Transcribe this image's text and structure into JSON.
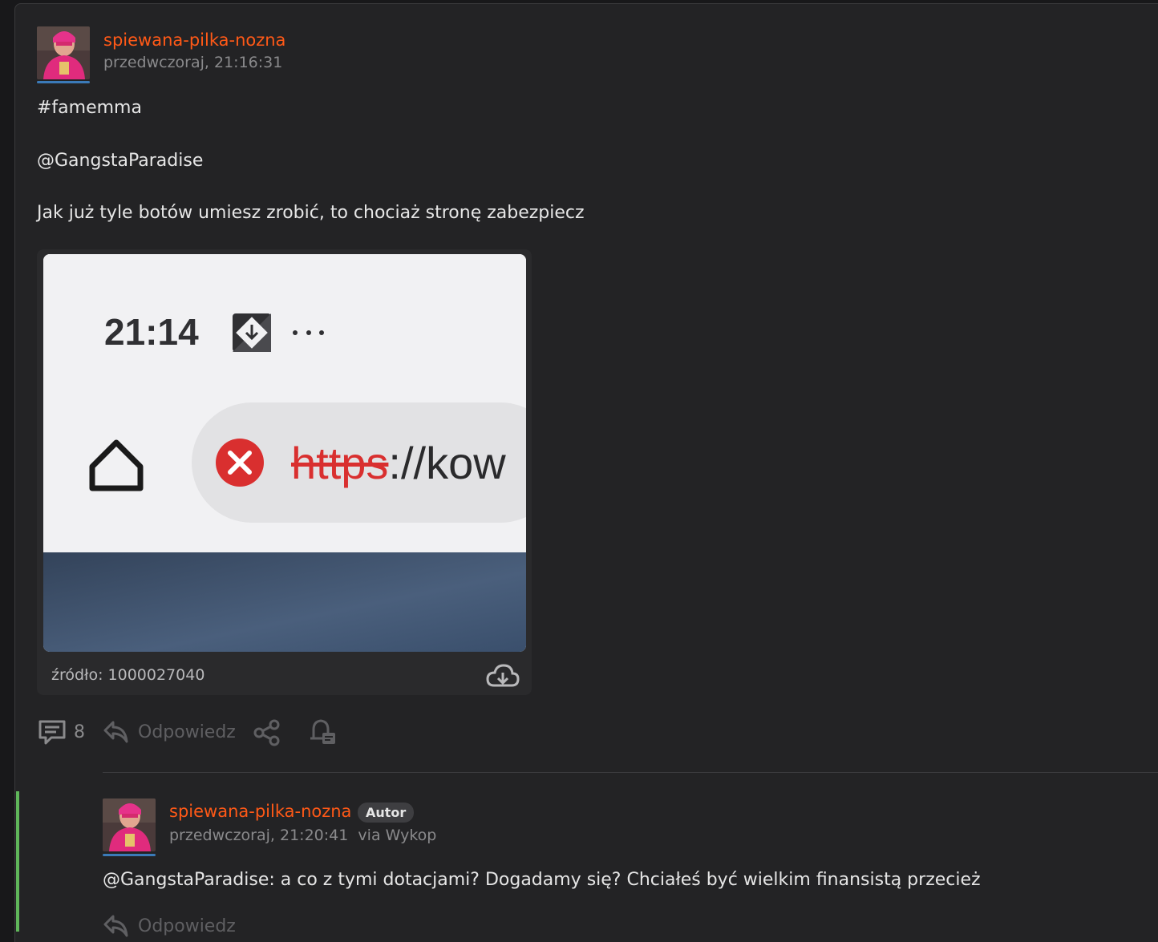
{
  "post": {
    "username": "spiewana-pilka-nozna",
    "timestamp": "przedwczoraj, 21:16:31",
    "tag": "#famemma",
    "mention": "@GangstaParadise",
    "text": "Jak już tyle botów umiesz zrobić, to chociaż stronę zabezpiecz",
    "embed": {
      "time": "21:14",
      "url_scheme": "https",
      "url_rest": "://kow",
      "source": "źródło: 1000027040"
    },
    "actions": {
      "comment_count": "8",
      "reply_label": "Odpowiedz"
    }
  },
  "reply": {
    "username": "spiewana-pilka-nozna",
    "badge": "Autor",
    "timestamp": "przedwczoraj, 21:20:41",
    "via": "via Wykop",
    "mention": "@GangstaParadise",
    "text": ": a co z tymi dotacjami? Dogadamy się? Chciałeś być wielkim finansistą przecież",
    "reply_label": "Odpowiedz"
  },
  "colors": {
    "accent": "#ff5917",
    "background": "#232325",
    "thread_line": "#5fb65a"
  }
}
